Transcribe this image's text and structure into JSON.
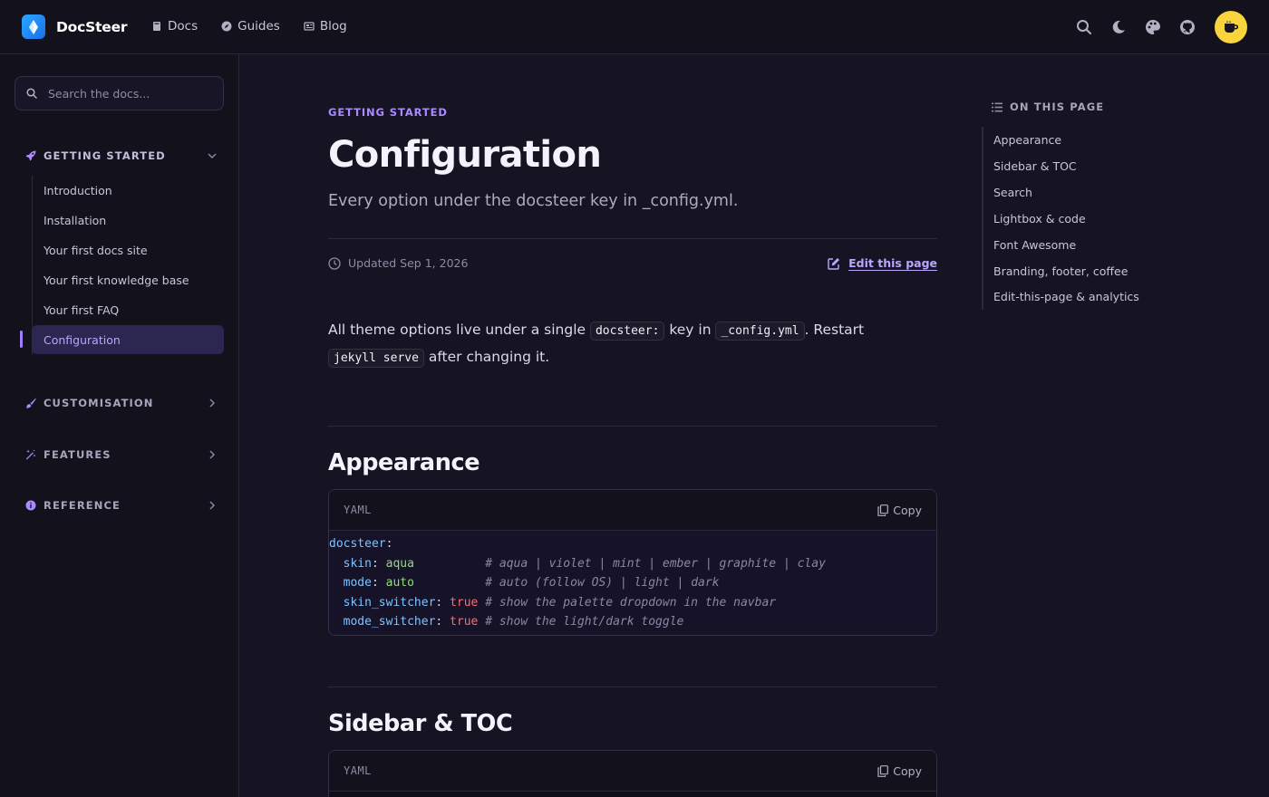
{
  "navbar": {
    "brand": "DocSteer",
    "links": [
      {
        "label": "Docs",
        "icon": "book-icon"
      },
      {
        "label": "Guides",
        "icon": "compass-icon"
      },
      {
        "label": "Blog",
        "icon": "newspaper-icon"
      }
    ],
    "icons": [
      "search-icon",
      "moon-icon",
      "palette-icon",
      "github-icon",
      "coffee-icon"
    ]
  },
  "sidebar": {
    "search_placeholder": "Search the docs...",
    "sections": [
      {
        "label": "GETTING STARTED",
        "icon": "rocket-icon",
        "expanded": true
      },
      {
        "label": "CUSTOMISATION",
        "icon": "brush-icon",
        "expanded": false
      },
      {
        "label": "FEATURES",
        "icon": "magic-wand-icon",
        "expanded": false
      },
      {
        "label": "REFERENCE",
        "icon": "info-icon",
        "expanded": false
      }
    ],
    "items": [
      {
        "label": "Introduction"
      },
      {
        "label": "Installation"
      },
      {
        "label": "Your first docs site"
      },
      {
        "label": "Your first knowledge base"
      },
      {
        "label": "Your first FAQ"
      },
      {
        "label": "Configuration",
        "active": true
      }
    ]
  },
  "main": {
    "eyebrow": "GETTING STARTED",
    "title": "Configuration",
    "subtitle": "Every option under the docsteer key in _config.yml.",
    "updated": "Updated Sep 1, 2026",
    "edit_link": "Edit this page",
    "intro": {
      "t1": "All theme options live under a single ",
      "c1": "docsteer:",
      "t2": " key in ",
      "c2": "_config.yml",
      "t3": ". Restart ",
      "c3": "jekyll serve",
      "t4": " after changing it."
    },
    "sections": [
      {
        "heading": "Appearance",
        "code_lang": "YAML",
        "copy_label": "Copy",
        "code": {
          "root_key": "docsteer",
          "lines": [
            {
              "key": "skin",
              "value": "aqua",
              "type": "s",
              "pad": "          ",
              "comment": "# aqua | violet | mint | ember | graphite | clay"
            },
            {
              "key": "mode",
              "value": "auto",
              "type": "s",
              "pad": "          ",
              "comment": "# auto (follow OS) | light | dark"
            },
            {
              "key": "skin_switcher",
              "value": "true",
              "type": "b",
              "pad": " ",
              "comment": "# show the palette dropdown in the navbar"
            },
            {
              "key": "mode_switcher",
              "value": "true",
              "type": "b",
              "pad": " ",
              "comment": "# show the light/dark toggle"
            }
          ]
        }
      },
      {
        "heading": "Sidebar & TOC",
        "code_lang": "YAML",
        "copy_label": "Copy"
      }
    ]
  },
  "toc": {
    "title": "ON THIS PAGE",
    "items": [
      "Appearance",
      "Sidebar & TOC",
      "Search",
      "Lightbox & code",
      "Font Awesome",
      "Branding, footer, coffee",
      "Edit-this-page & analytics"
    ]
  },
  "colors": {
    "background": "#161422",
    "accent": "#a98bff",
    "brand_logo": "#2aa8ff",
    "coffee_button": "#f8d53c"
  }
}
